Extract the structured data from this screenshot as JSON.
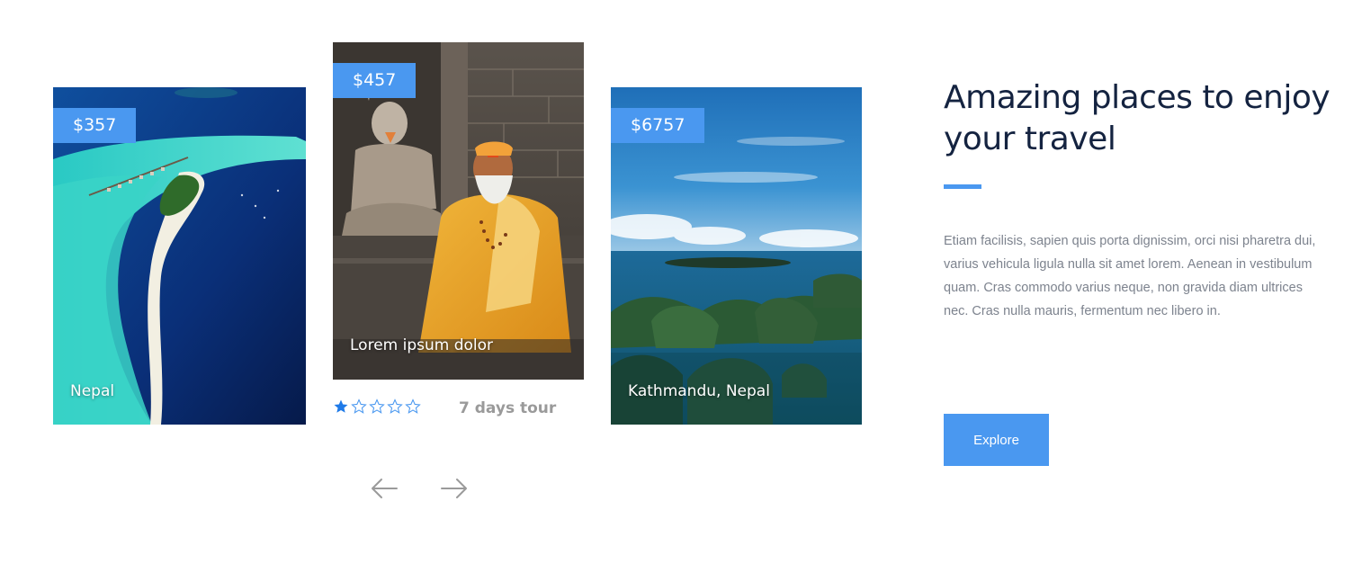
{
  "cards": [
    {
      "price": "$357",
      "caption": "Nepal"
    },
    {
      "price": "$457",
      "caption": "Lorem ipsum dolor",
      "rating": 1,
      "rating_max": 5,
      "duration": "7 days tour"
    },
    {
      "price": "$6757",
      "caption": "Kathmandu, Nepal"
    }
  ],
  "carousel": {
    "prev_icon": "arrow-left-icon",
    "next_icon": "arrow-right-icon"
  },
  "intro": {
    "heading": "Amazing places to enjoy your travel",
    "description": "Etiam facilisis, sapien quis porta dignissim, orci nisi pharetra dui, varius vehicula ligula nulla sit amet lorem. Aenean in vestibulum quam. Cras commodo varius neque, non gravida diam ultrices nec. Cras nulla mauris, fermentum nec libero in.",
    "button_label": "Explore"
  },
  "colors": {
    "accent": "#4a98f0",
    "heading": "#142340",
    "body_text": "#7d838e",
    "muted_text": "#9a9a9a"
  }
}
